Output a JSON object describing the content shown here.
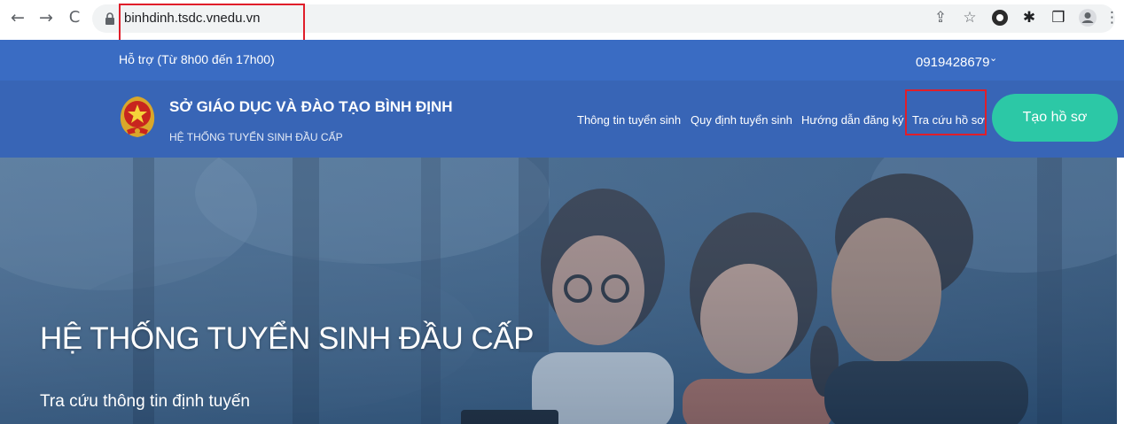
{
  "browser": {
    "url": "binhdinh.tsdc.vnedu.vn",
    "back_icon": "←",
    "forward_icon": "→",
    "reload_icon": "C",
    "share_icon": "⇪",
    "star_icon": "☆",
    "extension_icon": "✱",
    "sidepanel_icon": "❒",
    "menu_icon": "⋮"
  },
  "support": {
    "hours_text": "Hỗ trợ (Từ 8h00 đến 17h00)",
    "phone": "0919428679",
    "chevron": "⌄"
  },
  "header": {
    "title": "SỞ GIÁO DỤC VÀ ĐÀO TẠO BÌNH ĐỊNH",
    "subtitle": "HỆ THỐNG TUYỂN SINH ĐẦU CẤP",
    "nav": [
      {
        "label": "Thông tin tuyển sinh"
      },
      {
        "label": "Quy định tuyển sinh"
      },
      {
        "label": "Hướng dẫn đăng ký"
      },
      {
        "label": "Tra cứu hồ sơ"
      }
    ],
    "create_button": "Tạo hồ sơ"
  },
  "hero": {
    "title": "HỆ THỐNG TUYỂN SINH ĐẦU CẤP",
    "subtitle": "Tra cứu thông tin định tuyến"
  },
  "colors": {
    "support_bar": "#3a6cc3",
    "header": "#3865b6",
    "accent_button": "#2cc8a6",
    "highlight": "#e01e2a"
  }
}
